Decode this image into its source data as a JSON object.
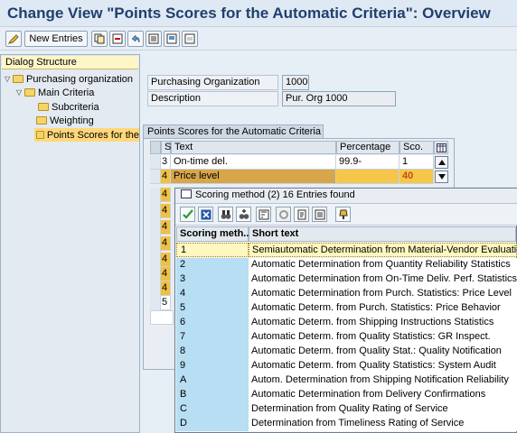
{
  "title": "Change View \"Points Scores for the Automatic Criteria\": Overview",
  "toolbar": {
    "new_entries_label": "New Entries"
  },
  "dialog_structure": {
    "header": "Dialog Structure",
    "items": [
      {
        "label": "Purchasing organization",
        "expanded": true
      },
      {
        "label": "Main Criteria",
        "expanded": true
      },
      {
        "label": "Subcriteria"
      },
      {
        "label": "Weighting"
      },
      {
        "label": "Points Scores for the"
      }
    ]
  },
  "form": {
    "purch_org_label": "Purchasing Organization",
    "purch_org_value": "1000",
    "description_label": "Description",
    "description_value": "Pur. Org 1000"
  },
  "table": {
    "group_title": "Points Scores for the Automatic Criteria",
    "columns": [
      "S",
      "Text",
      "Percentage",
      "Sco."
    ],
    "rows": [
      {
        "s": "3",
        "text": "On-time del.",
        "percentage": "99.9-",
        "score": "1"
      },
      {
        "s": "4",
        "text": "Price level",
        "percentage": "",
        "score": "40"
      },
      {
        "s": "4"
      },
      {
        "s": "4"
      },
      {
        "s": "4"
      },
      {
        "s": "4"
      },
      {
        "s": "4"
      },
      {
        "s": "4"
      },
      {
        "s": "4"
      },
      {
        "s": "5"
      }
    ]
  },
  "popup": {
    "title": "Scoring method (2)   16 Entries found",
    "columns": [
      "Scoring meth...",
      "Short text"
    ],
    "rows": [
      {
        "code": "1",
        "text": "Semiautomatic Determination from Material-Vendor Evaluation"
      },
      {
        "code": "2",
        "text": "Automatic Determination from Quantity Reliability Statistics"
      },
      {
        "code": "3",
        "text": "Automatic Determination from On-Time Deliv. Perf. Statistics"
      },
      {
        "code": "4",
        "text": "Automatic Determination from Purch. Statistics: Price Level"
      },
      {
        "code": "5",
        "text": "Automatic Determ. from Purch. Statistics: Price Behavior"
      },
      {
        "code": "6",
        "text": "Automatic Determ. from Shipping Instructions Statistics"
      },
      {
        "code": "7",
        "text": "Automatic Determ. from Quality Statistics: GR Inspect."
      },
      {
        "code": "8",
        "text": "Automatic Determ. from Quality Stat.: Quality Notification"
      },
      {
        "code": "9",
        "text": "Automatic Determ. from Quality Statistics: System Audit"
      },
      {
        "code": "A",
        "text": "Autom. Determination from Shipping Notification Reliability"
      },
      {
        "code": "B",
        "text": "Automatic Determination from Delivery Confirmations"
      },
      {
        "code": "C",
        "text": "Determination from Quality Rating of Service"
      },
      {
        "code": "D",
        "text": "Determination from Timeliness Rating of Service"
      }
    ]
  }
}
